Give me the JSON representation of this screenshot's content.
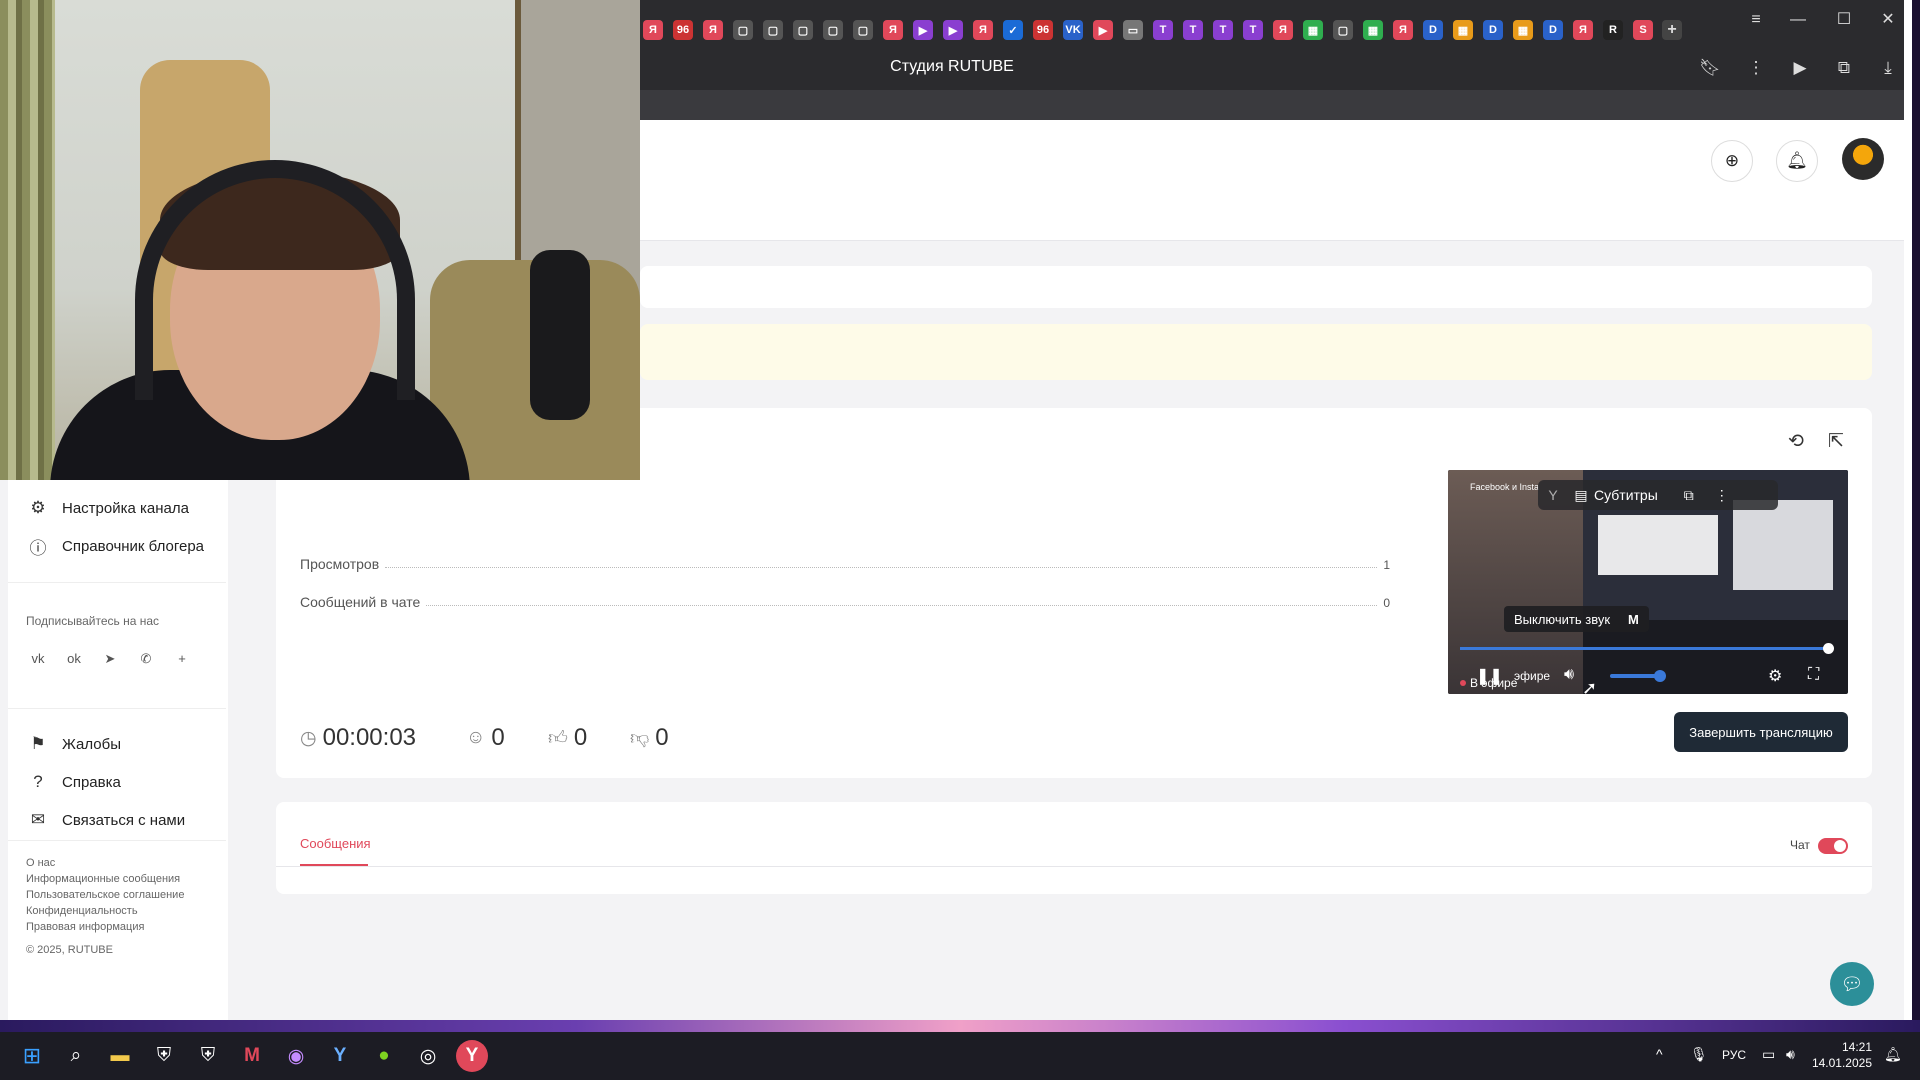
{
  "browser": {
    "title": "Студия RUTUBE",
    "favicons": [
      "Я",
      "96",
      "Я",
      "▢",
      "▢",
      "▢",
      "▢",
      "▢",
      "Я",
      "▶",
      "▶",
      "Я",
      "✓",
      "96",
      "VK",
      "▶",
      "▭",
      "T",
      "T",
      "T",
      "T",
      "Я",
      "▦",
      "▢",
      "▦",
      "Я",
      "D",
      "▦",
      "D",
      "▦",
      "D",
      "Я",
      "R",
      "S"
    ],
    "new_tab": "+",
    "window_controls": {
      "menu": "≡",
      "minimize": "—",
      "maximize": "☐",
      "close": "✕"
    }
  },
  "sidebar": {
    "items_top": [
      {
        "icon": "gear-icon",
        "glyph": "⚙",
        "label": "Настройка канала"
      },
      {
        "icon": "info-icon",
        "glyph": "ⓘ",
        "label": "Справочник блогера"
      }
    ],
    "follow_label": "Подписывайтесь на нас",
    "socials": [
      {
        "icon": "vk-icon",
        "glyph": "vk"
      },
      {
        "icon": "ok-icon",
        "glyph": "ok"
      },
      {
        "icon": "telegram-icon",
        "glyph": "➤"
      },
      {
        "icon": "viber-icon",
        "glyph": "✆"
      },
      {
        "icon": "more-icon",
        "glyph": "+"
      }
    ],
    "items_bottom": [
      {
        "icon": "flag-icon",
        "glyph": "⚑",
        "label": "Жалобы"
      },
      {
        "icon": "help-icon",
        "glyph": "?",
        "label": "Справка"
      },
      {
        "icon": "mail-icon",
        "glyph": "✉",
        "label": "Связаться с нами"
      }
    ],
    "footer_links": [
      "О нас",
      "Информационные сообщения",
      "Пользовательское соглашение",
      "Конфиденциальность",
      "Правовая информация"
    ],
    "copyright": "© 2025, RUTUBE"
  },
  "stats": {
    "views_label": "Просмотров",
    "views_value": "1",
    "chat_label": "Сообщений в чате",
    "chat_value": "0",
    "duration": "00:00:03",
    "viewers": "0",
    "likes": "0",
    "dislikes": "0"
  },
  "player": {
    "subtitles_label": "Субтитры",
    "mute_tooltip": "Выключить звук",
    "mute_key": "M",
    "live_label": "В эфире",
    "live_overlap": "эфире",
    "volume": 0.8,
    "progress": 0.98,
    "overlay_text": "Facebook и Insta"
  },
  "actions": {
    "finish_stream": "Завершить трансляцию"
  },
  "messages": {
    "tab_label": "Сообщения",
    "chat_toggle_label": "Чат",
    "chat_enabled": true
  },
  "taskbar": {
    "lang": "РУС",
    "time": "14:21",
    "date": "14.01.2025"
  },
  "colors": {
    "accent": "#e0485a",
    "dark_button": "#1f2a36",
    "player_blue": "#3a79d9",
    "fab": "#2c8f99"
  }
}
